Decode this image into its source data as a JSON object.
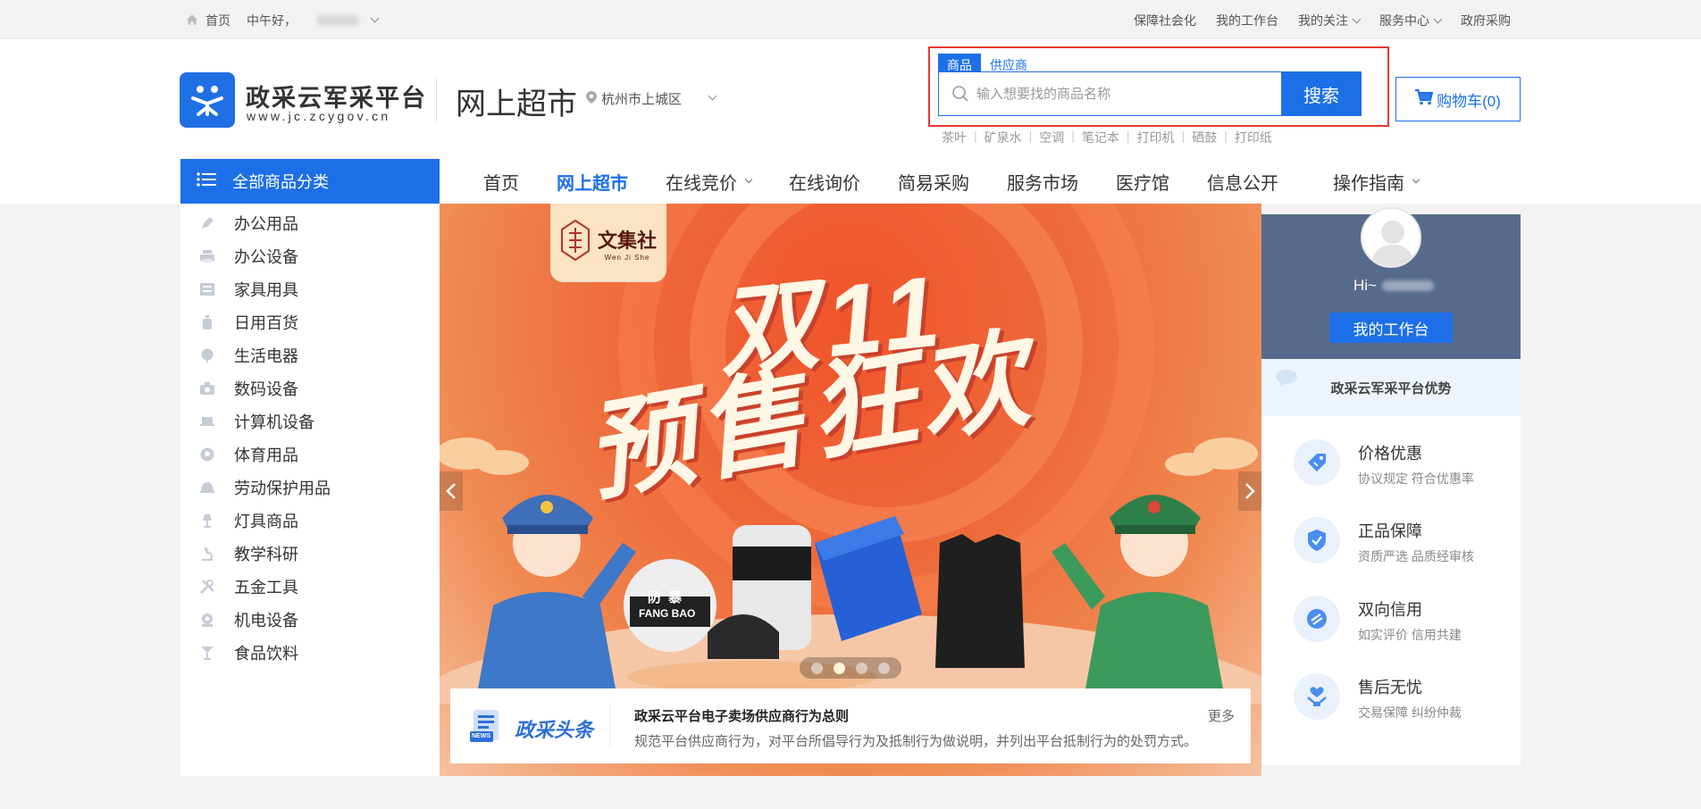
{
  "topbar": {
    "home": "首页",
    "greeting": "中午好，",
    "links": [
      "保障社会化",
      "我的工作台",
      "我的关注",
      "服务中心",
      "政府采购"
    ]
  },
  "header": {
    "logo_title": "政采云军采平台",
    "logo_url": "www.jc.zcygov.cn",
    "market_title": "网上超市",
    "city": "杭州市上城区",
    "search": {
      "tabs": [
        "商品",
        "供应商"
      ],
      "placeholder": "输入想要找的商品名称",
      "button": "搜索",
      "hotwords": [
        "茶叶",
        "矿泉水",
        "空调",
        "笔记本",
        "打印机",
        "硒鼓",
        "打印纸"
      ]
    },
    "cart_label": "购物车(0)"
  },
  "nav": {
    "all_categories": "全部商品分类",
    "items": [
      "首页",
      "网上超市",
      "在线竞价",
      "在线询价",
      "简易采购",
      "服务市场",
      "医疗馆",
      "信息公开",
      "操作指南"
    ]
  },
  "sidebar": {
    "categories": [
      "办公用品",
      "办公设备",
      "家具用具",
      "日用百货",
      "生活电器",
      "数码设备",
      "计算机设备",
      "体育用品",
      "劳动保护用品",
      "灯具商品",
      "教学科研",
      "五金工具",
      "机电设备",
      "食品饮料"
    ]
  },
  "banner": {
    "brand": "文集社",
    "brand_sub": "Wen Ji She",
    "headline_line1": "双11",
    "headline_line2": "预售狂欢",
    "product_labels": [
      "防 暴",
      "FANG BAO"
    ],
    "slide_count": 4,
    "active_slide": 2,
    "news": {
      "logo": "政采头条",
      "logo_badge": "NEWS",
      "title": "政采云平台电子卖场供应商行为总则",
      "desc": "规范平台供应商行为，对平台所倡导行为及抵制行为做说明，并列出平台抵制行为的处罚方式。",
      "more": "更多"
    }
  },
  "user_panel": {
    "hi": "Hi~",
    "workbench_button": "我的工作台",
    "advantage_title": "政采云军采平台优势",
    "features": [
      {
        "title": "价格优惠",
        "desc": "协议规定 符合优惠率",
        "icon": "price-tag-icon"
      },
      {
        "title": "正品保障",
        "desc": "资质严选 品质经审核",
        "icon": "shield-check-icon"
      },
      {
        "title": "双向信用",
        "desc": "如实评价 信用共建",
        "icon": "credit-icon"
      },
      {
        "title": "售后无忧",
        "desc": "交易保障 纠纷仲裁",
        "icon": "heart-hands-icon"
      }
    ]
  },
  "colors": {
    "accent": "#1d6fe8",
    "search_highlight": "#e53935",
    "panel_top": "#566b8c"
  }
}
